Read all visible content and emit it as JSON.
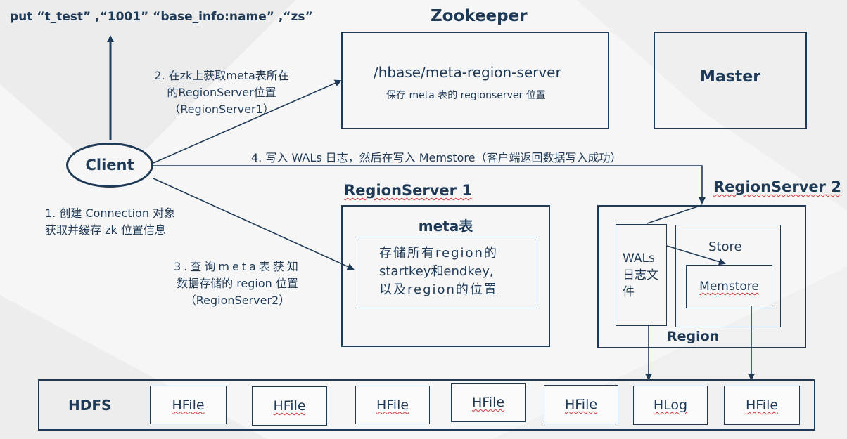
{
  "command": "put  “t_test” ,“1001”   “base_info:name” ,“zs”",
  "zookeeper": {
    "title": "Zookeeper",
    "path": "/hbase/meta-region-server",
    "desc": "保存 meta 表的 regionserver 位置"
  },
  "master": {
    "title": "Master"
  },
  "client": {
    "label": "Client"
  },
  "steps": {
    "step1": [
      "1. 创建 Connection 对象",
      "获取并缓存 zk 位置信息"
    ],
    "step2": [
      "2.  在zk上获取meta表所在",
      "的RegionServer位置",
      "（RegionServer1）"
    ],
    "step3": [
      "3.查询meta表获知",
      "数据存储的 region 位置",
      "（RegionServer2）"
    ],
    "step4": "4. 写入 WALs 日志，然后在写入 Memstore（客户端返回数据写入成功）"
  },
  "regionserver1": {
    "title": "RegionServer 1",
    "meta_title": "meta表",
    "meta_content": [
      "存储所有region的",
      "startkey和endkey,",
      "以及region的位置"
    ]
  },
  "regionserver2": {
    "title": "RegionServer 2",
    "wals": [
      "WALs",
      "日志文",
      "件"
    ],
    "store": "Store",
    "memstore": "Memstore",
    "region": "Region"
  },
  "hdfs": {
    "title": "HDFS",
    "files": [
      "HFile",
      "HFile",
      "HFile",
      "HFile",
      "HFile",
      "HLog",
      "HFile"
    ]
  },
  "colors": {
    "primary": "#1f3a57",
    "background": "#f6f6f6",
    "spellcheck": "#d23a3a"
  }
}
